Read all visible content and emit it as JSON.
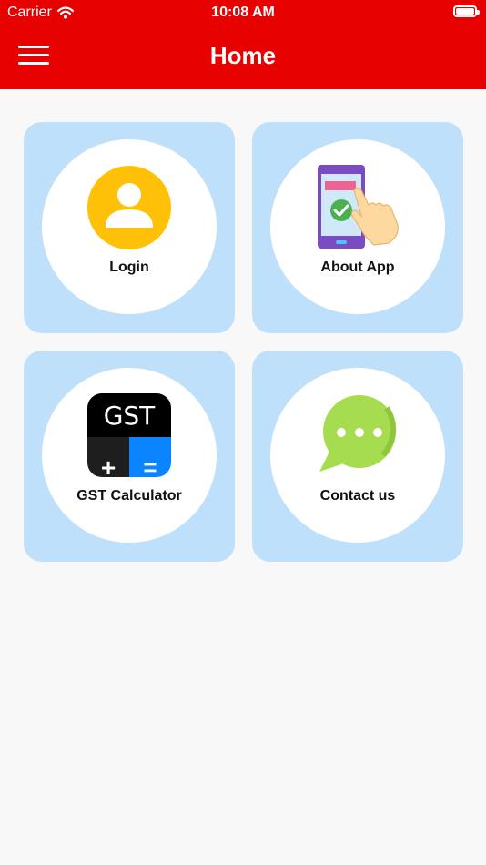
{
  "status_bar": {
    "carrier": "Carrier",
    "time": "10:08 AM"
  },
  "header": {
    "title": "Home",
    "menu_icon": "hamburger-menu-icon"
  },
  "colors": {
    "header": "#e60000",
    "tile": "#bfe0fa",
    "background": "#f8f8f8"
  },
  "tiles": [
    {
      "label": "Login",
      "icon": "user-avatar-icon"
    },
    {
      "label": "About App",
      "icon": "phone-tap-icon"
    },
    {
      "label": "GST Calculator",
      "icon": "gst-calculator-icon"
    },
    {
      "label": "Contact us",
      "icon": "chat-bubble-icon"
    }
  ],
  "gst_icon": {
    "text": "GST",
    "plus": "+",
    "equals": "="
  }
}
